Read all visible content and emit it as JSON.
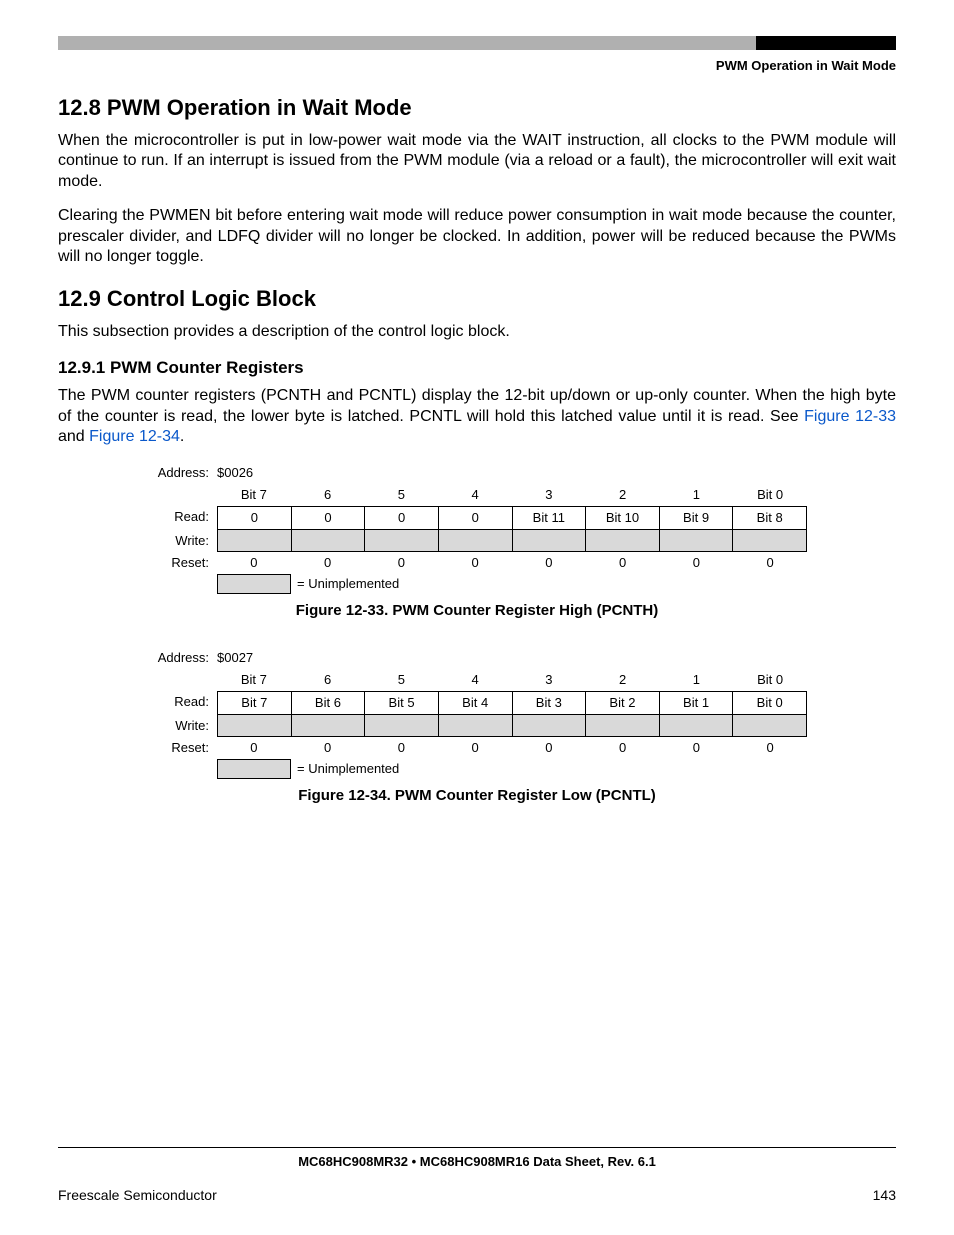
{
  "header": {
    "running": "PWM Operation in Wait Mode"
  },
  "sections": {
    "s128": {
      "heading": "12.8  PWM Operation in Wait Mode",
      "p1": "When the microcontroller is put in low-power wait mode via the WAIT instruction, all clocks to the PWM module will continue to run. If an interrupt is issued from the PWM module (via a reload or a fault), the microcontroller will exit wait mode.",
      "p2": "Clearing the PWMEN bit before entering wait mode will reduce power consumption in wait mode because the counter, prescaler divider, and LDFQ divider will no longer be clocked. In addition, power will be reduced because the PWMs will no longer toggle."
    },
    "s129": {
      "heading": "12.9  Control Logic Block",
      "p1": "This subsection provides a description of the control logic block."
    },
    "s1291": {
      "heading": "12.9.1  PWM Counter Registers",
      "p1_pre": "The PWM counter registers (PCNTH and PCNTL) display the 12-bit up/down or up-only counter. When the high byte of the counter is read, the lower byte is latched. PCNTL will hold this latched value until it is read. See ",
      "link1": "Figure 12-33",
      "mid": " and ",
      "link2": "Figure 12-34",
      "post": "."
    }
  },
  "reg33": {
    "addressLabel": "Address:",
    "address": "$0026",
    "bitHeaders": [
      "Bit 7",
      "6",
      "5",
      "4",
      "3",
      "2",
      "1",
      "Bit 0"
    ],
    "readLabel": "Read:",
    "read": [
      "0",
      "0",
      "0",
      "0",
      "Bit 11",
      "Bit 10",
      "Bit 9",
      "Bit 8"
    ],
    "writeLabel": "Write:",
    "resetLabel": "Reset:",
    "reset": [
      "0",
      "0",
      "0",
      "0",
      "0",
      "0",
      "0",
      "0"
    ],
    "legend": "= Unimplemented",
    "caption": "Figure 12-33. PWM Counter Register High (PCNTH)"
  },
  "reg34": {
    "addressLabel": "Address:",
    "address": "$0027",
    "bitHeaders": [
      "Bit 7",
      "6",
      "5",
      "4",
      "3",
      "2",
      "1",
      "Bit 0"
    ],
    "readLabel": "Read:",
    "read": [
      "Bit 7",
      "Bit 6",
      "Bit 5",
      "Bit 4",
      "Bit 3",
      "Bit 2",
      "Bit 1",
      "Bit 0"
    ],
    "writeLabel": "Write:",
    "resetLabel": "Reset:",
    "reset": [
      "0",
      "0",
      "0",
      "0",
      "0",
      "0",
      "0",
      "0"
    ],
    "legend": "= Unimplemented",
    "caption": "Figure 12-34. PWM Counter Register Low (PCNTL)"
  },
  "footer": {
    "title": "MC68HC908MR32 • MC68HC908MR16 Data Sheet, Rev. 6.1",
    "left": "Freescale Semiconductor",
    "right": "143"
  }
}
